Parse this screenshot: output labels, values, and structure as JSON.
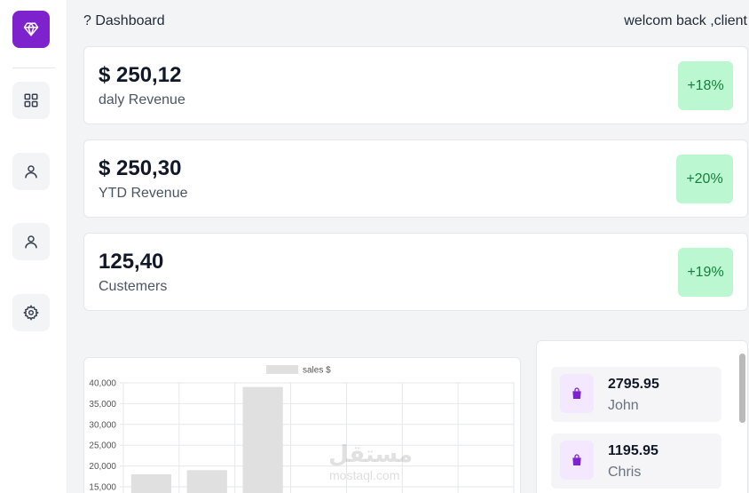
{
  "sidebar": {
    "items": [
      {
        "name": "diamond-icon",
        "active": true
      },
      {
        "name": "grid-icon",
        "active": false
      },
      {
        "name": "user-icon",
        "active": false
      },
      {
        "name": "user-icon",
        "active": false
      },
      {
        "name": "gear-icon",
        "active": false
      }
    ],
    "brand_color": "#7e22ce"
  },
  "header": {
    "title": "? Dashboard",
    "welcome": "welcom back ,client"
  },
  "stats": [
    {
      "value": "$ 250,12",
      "label": "daly Revenue",
      "change": "+18%"
    },
    {
      "value": "$ 250,30",
      "label": "YTD Revenue",
      "change": "+20%"
    },
    {
      "value": "125,40",
      "label": "Custemers",
      "change": "+19%"
    }
  ],
  "colors": {
    "badge_bg": "#bbf7d0",
    "badge_text": "#15803d",
    "bar": "#e0e0e0",
    "accent": "#7e22ce"
  },
  "chart_data": {
    "type": "bar",
    "legend": [
      "sales $"
    ],
    "ylim": [
      0,
      40000
    ],
    "yticks": [
      "40,000",
      "35,000",
      "30,000",
      "25,000",
      "20,000",
      "15,000"
    ],
    "categories": [
      "",
      "",
      "",
      "",
      "",
      "",
      ""
    ],
    "series": [
      {
        "name": "sales $",
        "values": [
          18000,
          19000,
          39000,
          null,
          null,
          null,
          null
        ]
      }
    ],
    "grid": true
  },
  "orders": [
    {
      "amount": "2795.95",
      "name": "John",
      "icon": "shopping-bag-icon"
    },
    {
      "amount": "1195.95",
      "name": "Chris",
      "icon": "shopping-bag-icon"
    }
  ],
  "watermark": {
    "text": "مستقل",
    "sub": "mostaql.com"
  }
}
